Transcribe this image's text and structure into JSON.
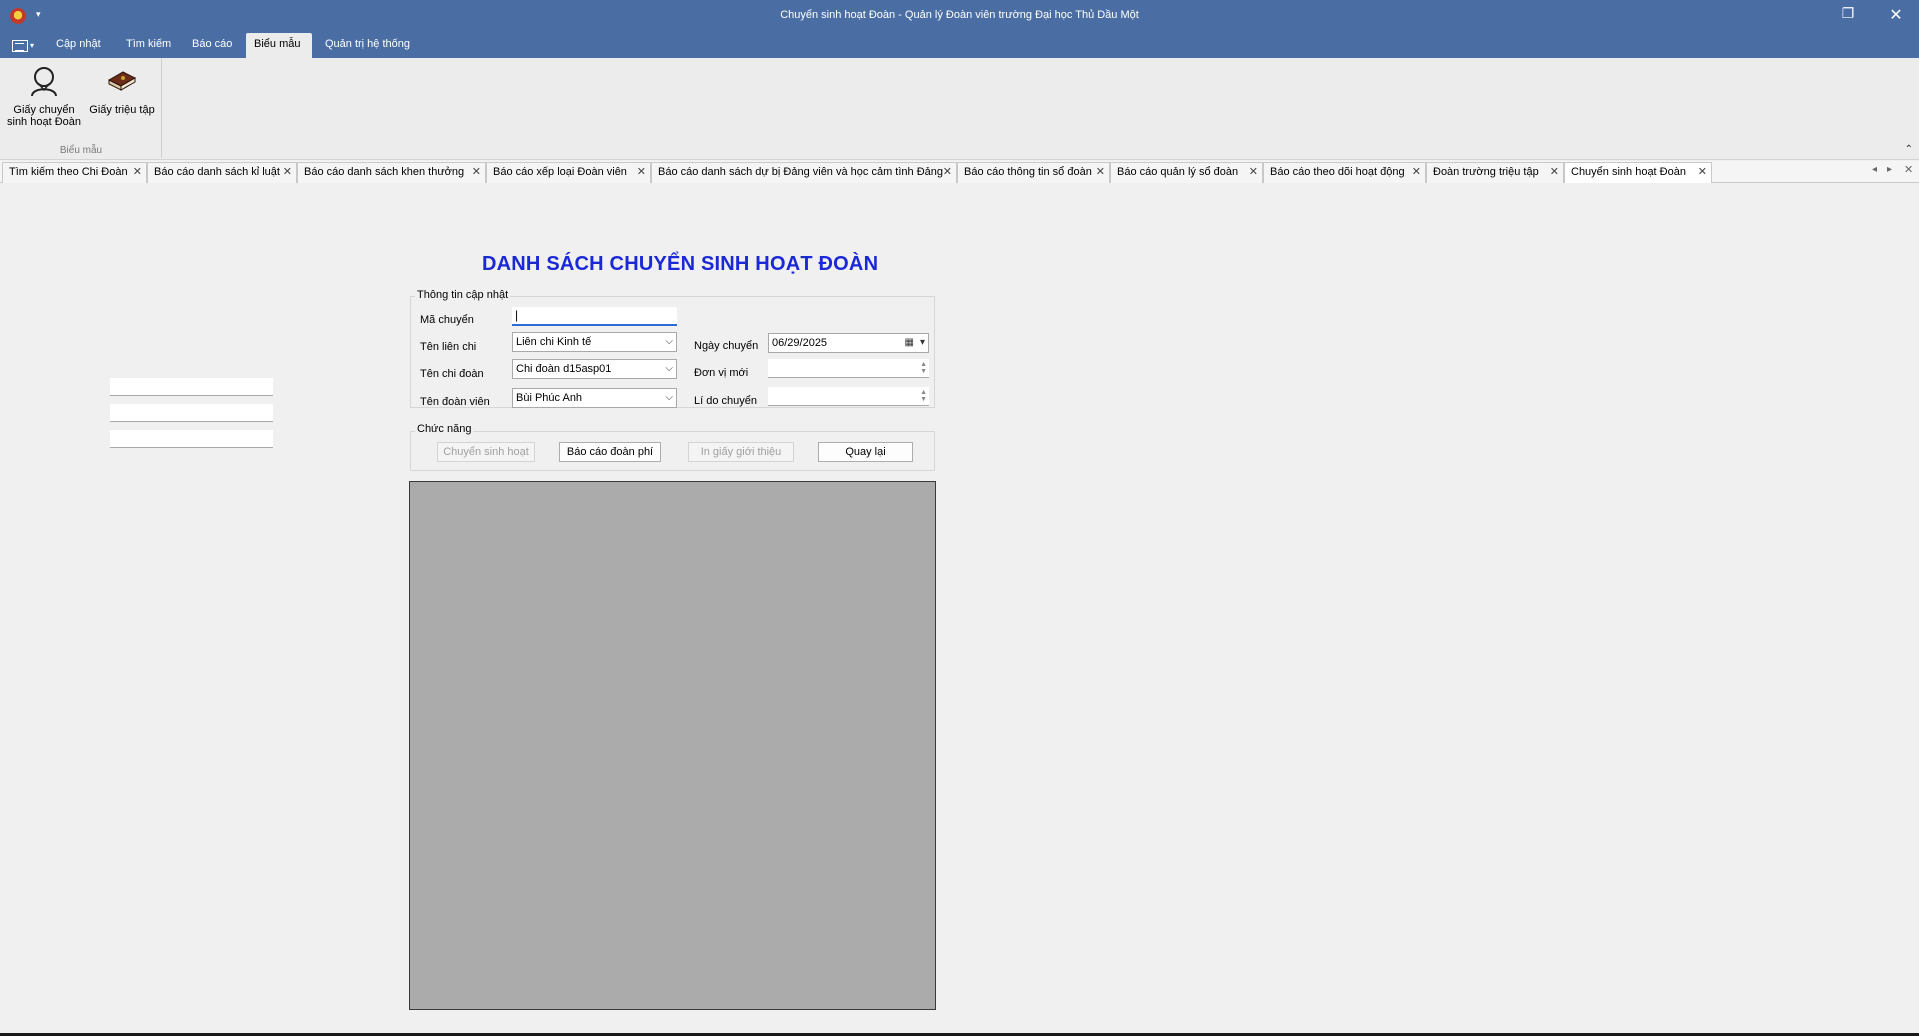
{
  "window": {
    "title": "Chuyển sinh hoạt Đoàn - Quản lý Đoàn viên trường Đại học Thủ Dầu Một"
  },
  "ribbon": {
    "tabs": [
      "Cập nhật",
      "Tìm kiếm",
      "Báo cáo",
      "Biểu mẫu",
      "Quản trị hệ thống"
    ],
    "active_tab": "Biểu mẫu",
    "group_label": "Biểu mẫu",
    "buttons": {
      "chuyen": "Giấy chuyển\nsinh hoạt Đoàn",
      "trieu_tap": "Giấy triệu tập"
    }
  },
  "doc_tabs": [
    "Tìm kiếm theo Chi Đoàn",
    "Báo cáo danh sách kỉ luật",
    "Báo cáo danh sách khen thưởng",
    "Báo cáo xếp loại Đoàn viên",
    "Báo cáo danh sách dự bị Đảng viên và học cảm tình Đảng",
    "Báo cáo thông tin sổ đoàn",
    "Báo cáo quản lý sổ đoàn",
    "Báo cáo theo dõi hoạt động",
    "Đoàn trường triệu tập",
    "Chuyển sinh hoạt Đoàn"
  ],
  "form": {
    "title": "DANH SÁCH CHUYỂN SINH HOẠT ĐOÀN",
    "info_group": "Thông tin cập nhật",
    "labels": {
      "ma_chuyen": "Mã chuyển",
      "ten_lien_chi": "Tên liên chi",
      "ten_chi_doan": "Tên chi đoàn",
      "ten_doan_vien": "Tên đoàn viên",
      "ngay_chuyen": "Ngày chuyển",
      "don_vi_moi": "Đơn vị mới",
      "li_do_chuyen": "Lí do chuyển"
    },
    "values": {
      "ma_chuyen": "",
      "ten_lien_chi": "Liên chi Kinh tế",
      "ten_chi_doan": "Chi đoàn d15asp01",
      "ten_doan_vien": "Bùi Phúc Anh",
      "ngay_chuyen": "06/29/2025",
      "don_vi_moi": "",
      "li_do_chuyen": ""
    },
    "function_group": "Chức năng",
    "buttons": {
      "chuyen_sinh_hoat": "Chuyển sinh hoạt",
      "bao_cao_doan_phi": "Báo cáo đoàn phí",
      "in_giay": "In giấy giới thiệu",
      "quay_lai": "Quay lại"
    }
  }
}
